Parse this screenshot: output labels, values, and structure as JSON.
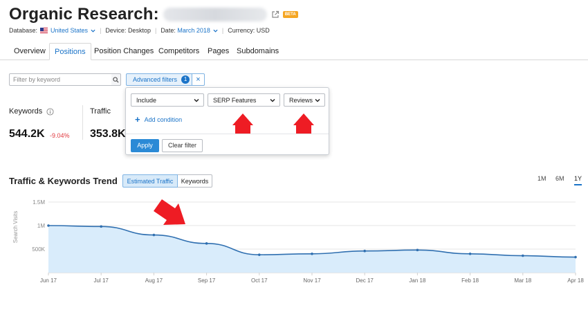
{
  "header": {
    "title": "Organic Research:",
    "beta_badge": "BETA"
  },
  "meta": {
    "database_label": "Database:",
    "database_value": "United States",
    "device_label": "Device:",
    "device_value": "Desktop",
    "date_label": "Date:",
    "date_value": "March 2018",
    "currency_label": "Currency:",
    "currency_value": "USD"
  },
  "tabs": [
    {
      "label": "Overview",
      "active": false
    },
    {
      "label": "Positions",
      "active": true
    },
    {
      "label": "Position Changes",
      "active": false
    },
    {
      "label": "Competitors",
      "active": false
    },
    {
      "label": "Pages",
      "active": false
    },
    {
      "label": "Subdomains",
      "active": false
    }
  ],
  "filters": {
    "keyword_placeholder": "Filter by keyword",
    "advanced_label": "Advanced filters",
    "advanced_count": "1",
    "close_symbol": "×"
  },
  "popup": {
    "include": "Include",
    "field": "SERP Features",
    "value": "Reviews",
    "add_condition": "Add condition",
    "plus": "+",
    "apply": "Apply",
    "clear": "Clear filter"
  },
  "kpis": {
    "keywords_label": "Keywords",
    "keywords_value": "544.2K",
    "keywords_change": "-9.04%",
    "traffic_label": "Traffic",
    "traffic_value": "353.8K"
  },
  "trend": {
    "title": "Traffic & Keywords Trend",
    "toggle_estimated": "Estimated Traffic",
    "toggle_keywords": "Keywords",
    "ranges": [
      {
        "label": "1M",
        "active": false
      },
      {
        "label": "6M",
        "active": false
      },
      {
        "label": "1Y",
        "active": true
      }
    ]
  },
  "colors": {
    "accent": "#1a73c8",
    "line": "#2f6fb0",
    "area": "#d9ecfb",
    "negative": "#e0383e",
    "annotation_arrow": "#ee1c24"
  },
  "chart_data": {
    "type": "area",
    "ylabel": "Search Visits",
    "y_ticks": [
      {
        "value": 500000,
        "label": "500K"
      },
      {
        "value": 1000000,
        "label": "1M"
      },
      {
        "value": 1500000,
        "label": "1.5M"
      }
    ],
    "ylim": [
      0,
      1500000
    ],
    "x": [
      "Jun 17",
      "Jul 17",
      "Aug 17",
      "Sep 17",
      "Oct 17",
      "Nov 17",
      "Dec 17",
      "Jan 18",
      "Feb 18",
      "Mar 18",
      "Apr 18"
    ],
    "series": [
      {
        "values": [
          1000000,
          980000,
          800000,
          620000,
          380000,
          400000,
          460000,
          480000,
          400000,
          360000,
          330000
        ]
      }
    ],
    "grid": true
  }
}
